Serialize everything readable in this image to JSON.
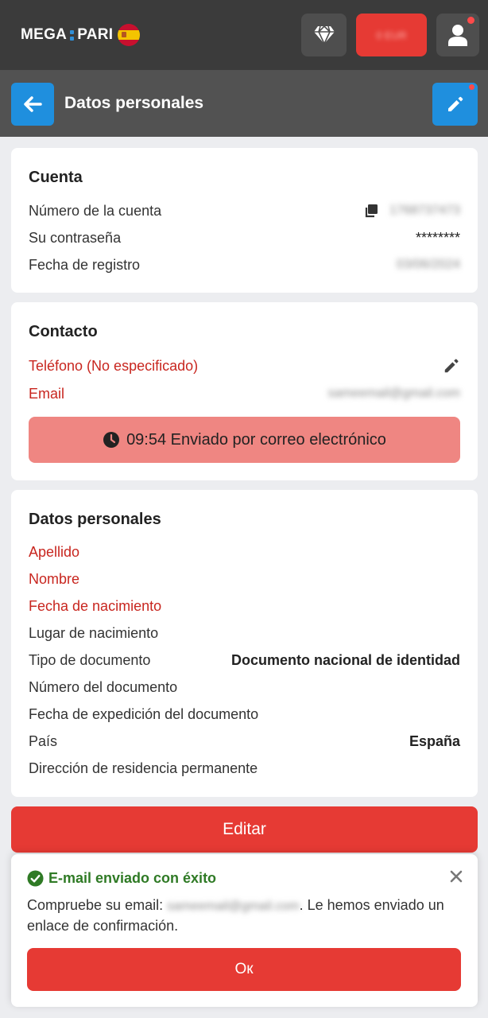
{
  "header": {
    "logo_left": "MEGA",
    "logo_right": "PARI",
    "balance": "0 EUR"
  },
  "subheader": {
    "title": "Datos personales"
  },
  "account": {
    "title": "Cuenta",
    "rows": [
      {
        "label": "Número de la cuenta",
        "value": "1768737473"
      },
      {
        "label": "Su contraseña",
        "value": "********"
      },
      {
        "label": "Fecha de registro",
        "value": "03/06/2024"
      }
    ]
  },
  "contact": {
    "title": "Contacto",
    "phone_label": "Teléfono (No especificado)",
    "email_label": "Email",
    "email_value": "sameemail@gmail.com",
    "sent_text": "09:54 Enviado por correo electrónico"
  },
  "personal": {
    "title": "Datos personales",
    "rows": [
      {
        "label": "Apellido",
        "value": ""
      },
      {
        "label": "Nombre",
        "value": ""
      },
      {
        "label": "Fecha de nacimiento",
        "value": ""
      },
      {
        "label": "Lugar de nacimiento",
        "value": ""
      },
      {
        "label": "Tipo de documento",
        "value": "Documento nacional de identidad"
      },
      {
        "label": "Número del documento",
        "value": ""
      },
      {
        "label": "Fecha de expedición del documento",
        "value": ""
      },
      {
        "label": "País",
        "value": "España"
      },
      {
        "label": "Dirección de residencia permanente",
        "value": ""
      }
    ]
  },
  "edit_button": "Editar",
  "toast": {
    "title": "E-mail enviado con éxito",
    "msg_before": "Compruebe su email: ",
    "msg_email": "sameemail@gmail.com",
    "msg_after": ". Le hemos enviado un enlace de confirmación.",
    "ok_label": "Ок"
  },
  "colors": {
    "accent_red": "#e63a34",
    "accent_blue": "#1f8fde",
    "required_red": "#c8261f",
    "success_green": "#2f7a25"
  }
}
